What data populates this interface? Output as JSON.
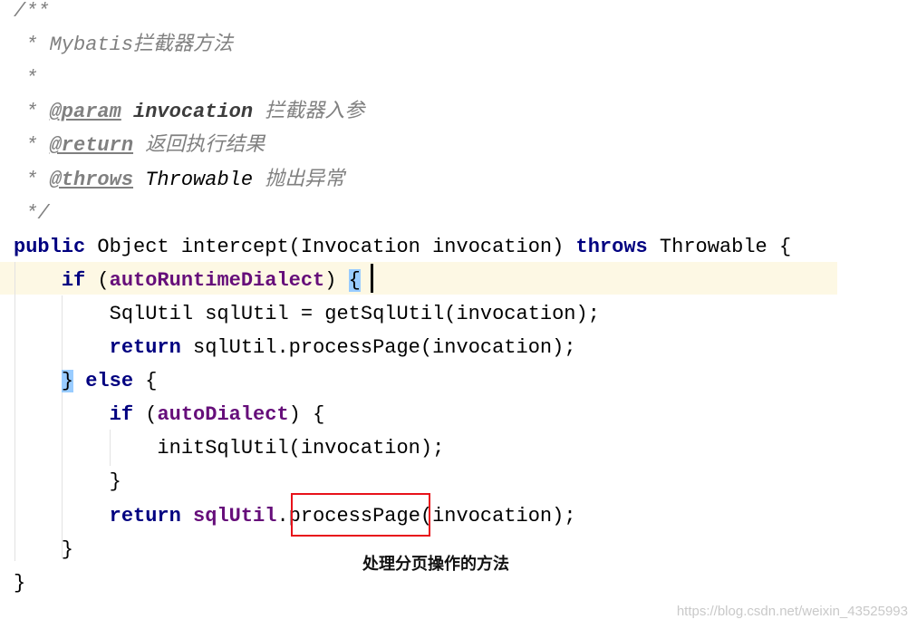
{
  "colors": {
    "keyword": "#000080",
    "field": "#660e7a",
    "comment": "#808080",
    "highlight_line": "#fdf8e4",
    "brace_match": "#99ccff",
    "annotation_box": "#e8121a"
  },
  "code": {
    "lines": [
      [
        {
          "t": "doc",
          "v": "/**"
        }
      ],
      [
        {
          "t": "doc",
          "v": " * Mybatis拦截器方法"
        }
      ],
      [
        {
          "t": "doc",
          "v": " *"
        }
      ],
      [
        {
          "t": "doc",
          "v": " * "
        },
        {
          "t": "tag",
          "v": "@param"
        },
        {
          "t": "doc",
          "v": " "
        },
        {
          "t": "docval",
          "v": "invocation"
        },
        {
          "t": "doc",
          "v": " 拦截器入参"
        }
      ],
      [
        {
          "t": "doc",
          "v": " * "
        },
        {
          "t": "tag",
          "v": "@return"
        },
        {
          "t": "doc",
          "v": " 返回执行结果"
        }
      ],
      [
        {
          "t": "doc",
          "v": " * "
        },
        {
          "t": "tag",
          "v": "@throws"
        },
        {
          "t": "doc",
          "v": " "
        },
        {
          "t": "doctype",
          "v": "Throwable"
        },
        {
          "t": "doc",
          "v": " 抛出异常"
        }
      ],
      [
        {
          "t": "doc",
          "v": " */"
        }
      ],
      [
        {
          "t": "kw",
          "v": "public"
        },
        {
          "t": "plain",
          "v": " Object intercept(Invocation invocation) "
        },
        {
          "t": "kw",
          "v": "throws"
        },
        {
          "t": "plain",
          "v": " Throwable {"
        }
      ],
      [
        {
          "t": "plain",
          "v": "    "
        },
        {
          "t": "kw",
          "v": "if"
        },
        {
          "t": "plain",
          "v": " ("
        },
        {
          "t": "field",
          "v": "autoRuntimeDialect"
        },
        {
          "t": "plain",
          "v": ") "
        },
        {
          "t": "brace-match",
          "v": "{"
        }
      ],
      [
        {
          "t": "plain",
          "v": "        SqlUtil sqlUtil = getSqlUtil(invocation);"
        }
      ],
      [
        {
          "t": "plain",
          "v": "        "
        },
        {
          "t": "kw",
          "v": "return"
        },
        {
          "t": "plain",
          "v": " sqlUtil.processPage(invocation);"
        }
      ],
      [
        {
          "t": "plain",
          "v": "    "
        },
        {
          "t": "brace-match",
          "v": "}"
        },
        {
          "t": "plain",
          "v": " "
        },
        {
          "t": "kw",
          "v": "else"
        },
        {
          "t": "plain",
          "v": " {"
        }
      ],
      [
        {
          "t": "plain",
          "v": "        "
        },
        {
          "t": "kw",
          "v": "if"
        },
        {
          "t": "plain",
          "v": " ("
        },
        {
          "t": "field",
          "v": "autoDialect"
        },
        {
          "t": "plain",
          "v": ") {"
        }
      ],
      [
        {
          "t": "plain",
          "v": "            initSqlUtil(invocation);"
        }
      ],
      [
        {
          "t": "plain",
          "v": "        }"
        }
      ],
      [
        {
          "t": "plain",
          "v": "        "
        },
        {
          "t": "kw",
          "v": "return"
        },
        {
          "t": "plain",
          "v": " "
        },
        {
          "t": "field",
          "v": "sqlUtil"
        },
        {
          "t": "plain",
          "v": ".processPage(invocation);"
        }
      ],
      [
        {
          "t": "plain",
          "v": "    }"
        }
      ],
      [
        {
          "t": "plain",
          "v": "}"
        }
      ]
    ]
  },
  "annotation": {
    "caption": "处理分页操作的方法"
  },
  "watermark": "https://blog.csdn.net/weixin_43525993"
}
